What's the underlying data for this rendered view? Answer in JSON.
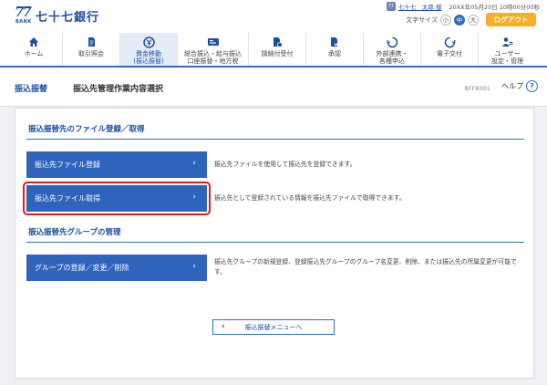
{
  "header": {
    "logo_number": "77",
    "logo_sub": "BANK",
    "bank_name": "七十七銀行",
    "user_icon": "user-badge-icon",
    "user_icon_text": "77",
    "user_name": "七十七　太郎 様",
    "last_login": "20XX年05月20日 10時00分00秒",
    "font_size_label": "文字サイズ",
    "font_sizes": [
      "小",
      "中",
      "大"
    ],
    "font_size_selected": "中",
    "logout_label": "ログアウト",
    "colors": {
      "brand": "#1d4fa0",
      "logout": "#f3b02a",
      "accent": "#2e6dc0"
    }
  },
  "nav": [
    {
      "label": "ホーム",
      "icon": "home-icon"
    },
    {
      "label": "取引照会",
      "icon": "document-search-icon"
    },
    {
      "label": "資金移動\n(振込振替)",
      "icon": "money-transfer-icon",
      "active": true
    },
    {
      "label": "総合振込・給与振込\n口座振替・地方税",
      "icon": "bulk-transfer-icon"
    },
    {
      "label": "請納付受付",
      "icon": "payment-icon"
    },
    {
      "label": "承認",
      "icon": "approval-icon"
    },
    {
      "label": "外部連携・\n各種申込",
      "icon": "link-icon"
    },
    {
      "label": "電子交付",
      "icon": "electronic-delivery-icon"
    },
    {
      "label": "ユーザー\n設定・管理",
      "icon": "user-settings-icon"
    }
  ],
  "breadcrumb": {
    "main": "振込振替",
    "sub": "振込先管理作業内容選択",
    "screen_id": "BFFK001",
    "help_label": "ヘルプ",
    "help_icon": "?"
  },
  "sections": [
    {
      "title": "振込振替先のファイル登録／取得",
      "items": [
        {
          "label": "振込先ファイル登録",
          "desc": "振込先ファイルを使用して振込先を登録できます。"
        },
        {
          "label": "振込先ファイル取得",
          "desc": "振込先として登録されている情報を振込先ファイルで取得できます。",
          "highlighted": true
        }
      ]
    },
    {
      "title": "振込振替先グループの管理",
      "items": [
        {
          "label": "グループの登録／変更／削除",
          "desc": "振込先グループの新規登録、登録振込先グループのグループ名変更、削除、または振込先の所属変更が可能です。"
        }
      ]
    }
  ],
  "back_button": {
    "label": "振込振替メニューへ"
  },
  "chevron": "›",
  "back_chevron": "‹"
}
